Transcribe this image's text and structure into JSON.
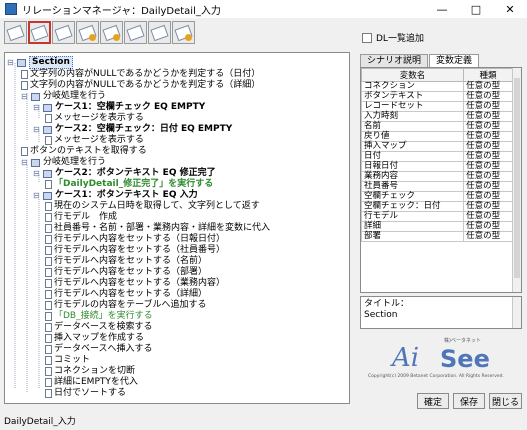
{
  "window": {
    "title": "リレーションマネージャ：DailyDetail_入力",
    "minimize": "—",
    "maximize": "□",
    "close": "✕"
  },
  "toolbar": {
    "buttons": [
      "toolbar-doc-1",
      "toolbar-doc-2",
      "toolbar-doc-3",
      "toolbar-doc-4",
      "toolbar-doc-5",
      "toolbar-doc-6",
      "toolbar-doc-7",
      "toolbar-doc-8"
    ]
  },
  "tree": {
    "root": "Section",
    "rows": [
      {
        "text": "文字列の内容がNULLであるかどうかを判定する（日付）",
        "kind": "doc"
      },
      {
        "text": "文字列の内容がNULLであるかどうかを判定する（詳細）",
        "kind": "doc"
      },
      {
        "text": "分岐処理を行う",
        "kind": "folder"
      },
      {
        "text": "ケース1：空欄チェック EQ EMPTY",
        "kind": "folder",
        "bold": true
      },
      {
        "text": "メッセージを表示する",
        "kind": "doc"
      },
      {
        "text": "ケース2：空欄チェック：日付 EQ EMPTY",
        "kind": "folder",
        "bold": true
      },
      {
        "text": "メッセージを表示する",
        "kind": "doc"
      },
      {
        "text": "ボタンのテキストを取得する",
        "kind": "doc"
      },
      {
        "text": "分岐処理を行う",
        "kind": "folder"
      },
      {
        "text": "ケース2：ボタンテキスト EQ 修正完了",
        "kind": "folder",
        "bold": true
      },
      {
        "text": "「DailyDetail_修正完了」を実行する",
        "kind": "doc",
        "green": true,
        "bold": true
      },
      {
        "text": "ケース1：ボタンテキスト EQ 入力",
        "kind": "folder",
        "bold": true
      },
      {
        "text": "現在のシステム日時を取得して、文字列として返す",
        "kind": "doc"
      },
      {
        "text": "行モデル　作成",
        "kind": "doc"
      },
      {
        "text": "社員番号・名前・部署・業務内容・詳細を変数に代入",
        "kind": "doc"
      },
      {
        "text": "行モデルへ内容をセットする（日報日付）",
        "kind": "doc"
      },
      {
        "text": "行モデルへ内容をセットする（社員番号）",
        "kind": "doc"
      },
      {
        "text": "行モデルへ内容をセットする（名前）",
        "kind": "doc"
      },
      {
        "text": "行モデルへ内容をセットする（部署）",
        "kind": "doc"
      },
      {
        "text": "行モデルへ内容をセットする（業務内容）",
        "kind": "doc"
      },
      {
        "text": "行モデルへ内容をセットする（詳細）",
        "kind": "doc"
      },
      {
        "text": "行モデルの内容をテーブルへ追加する",
        "kind": "doc"
      },
      {
        "text": "「DB_接続」を実行する",
        "kind": "doc",
        "green": true
      },
      {
        "text": "データベースを検索する",
        "kind": "doc"
      },
      {
        "text": "挿入マップを作成する",
        "kind": "doc"
      },
      {
        "text": "データベースへ挿入する",
        "kind": "doc"
      },
      {
        "text": "コミット",
        "kind": "doc"
      },
      {
        "text": "コネクションを切断",
        "kind": "doc"
      },
      {
        "text": "詳細にEMPTYを代入",
        "kind": "doc"
      },
      {
        "text": "日付でソートする",
        "kind": "doc"
      }
    ]
  },
  "dl_checkbox": "DL一覧追加",
  "tabs": [
    "シナリオ説明",
    "変数定義"
  ],
  "var_table": {
    "headers": [
      "変数名",
      "種類"
    ],
    "rows": [
      [
        "コネクション",
        "任意の型"
      ],
      [
        "ボタンテキスト",
        "任意の型"
      ],
      [
        "レコードセット",
        "任意の型"
      ],
      [
        "入力時刻",
        "任意の型"
      ],
      [
        "名前",
        "任意の型"
      ],
      [
        "戻り値",
        "任意の型"
      ],
      [
        "挿入マップ",
        "任意の型"
      ],
      [
        "日付",
        "任意の型"
      ],
      [
        "日報日付",
        "任意の型"
      ],
      [
        "業務内容",
        "任意の型"
      ],
      [
        "社員番号",
        "任意の型"
      ],
      [
        "空欄チェック",
        "任意の型"
      ],
      [
        "空欄チェック：日付",
        "任意の型"
      ],
      [
        "行モデル",
        "任意の型"
      ],
      [
        "詳細",
        "任意の型"
      ],
      [
        "部署",
        "任意の型"
      ]
    ]
  },
  "description": {
    "label": "タイトル：",
    "value": "Section"
  },
  "logo": {
    "small": "株)ベータネット",
    "ai": "Ai",
    "see": "See",
    "copyright": "Copyright(c) 2009 Betanet Corporation. All Rights Reserved."
  },
  "buttons": {
    "confirm": "確定",
    "save": "保存",
    "close": "閉じる"
  },
  "status": "DailyDetail_入力"
}
